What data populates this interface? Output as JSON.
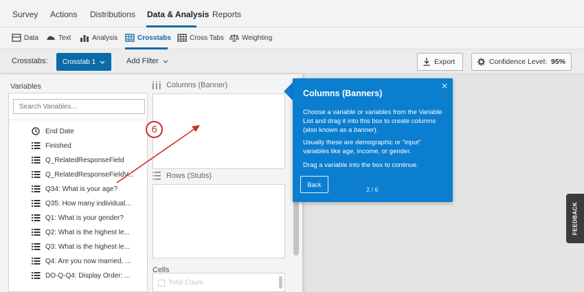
{
  "nav": {
    "tabs": [
      {
        "label": "Survey"
      },
      {
        "label": "Actions"
      },
      {
        "label": "Distributions"
      },
      {
        "label": "Data & Analysis"
      },
      {
        "label": "Reports"
      }
    ],
    "active_tab": "Data & Analysis"
  },
  "subnav": {
    "items": [
      {
        "label": "Data",
        "icon": "data-icon"
      },
      {
        "label": "Text",
        "icon": "text-icon"
      },
      {
        "label": "Analysis",
        "icon": "bar-chart-icon"
      },
      {
        "label": "Crosstabs",
        "icon": "grid-icon"
      },
      {
        "label": "Cross Tabs",
        "icon": "grid-icon"
      },
      {
        "label": "Weighting",
        "icon": "scale-icon"
      }
    ],
    "active_item": "Crosstabs"
  },
  "toolbar": {
    "crosstabs_label": "Crosstabs:",
    "crosstab_button": "Crosstab 1",
    "add_filter": "Add Filter",
    "export_label": "Export",
    "confidence_label": "Confidence Level:",
    "confidence_value": "95%"
  },
  "variables": {
    "title": "Variables",
    "search_placeholder": "Search Variables...",
    "items": [
      {
        "label": "End Date",
        "icon": "clock-icon"
      },
      {
        "label": "Finished",
        "icon": "list-icon"
      },
      {
        "label": "Q_RelatedResponseField",
        "icon": "list-icon"
      },
      {
        "label": "Q_RelatedResponseFieldV...",
        "icon": "list-icon"
      },
      {
        "label": "Q34: What is your age?",
        "icon": "list-icon"
      },
      {
        "label": "Q35: How many individual...",
        "icon": "list-icon"
      },
      {
        "label": "Q1: What is your gender?",
        "icon": "list-icon"
      },
      {
        "label": "Q2: What is the highest le...",
        "icon": "list-icon"
      },
      {
        "label": "Q3: What is the highest le...",
        "icon": "list-icon"
      },
      {
        "label": "Q4: Are you now married, ...",
        "icon": "list-icon"
      },
      {
        "label": "DO-Q-Q4: Display Order: ...",
        "icon": "list-icon"
      }
    ]
  },
  "sections": {
    "columns": "Columns (Banner)",
    "rows": "Rows (Stubs)",
    "cells": "Cells",
    "cells_option": "Total Count"
  },
  "popup": {
    "title": "Columns (Banners)",
    "close": "×",
    "p1_a": "Choose a variable or variables from the Variable List and drag it into this box to create ",
    "p1_em1": "columns",
    "p1_b": " (also known as a ",
    "p1_em2": "banner",
    "p1_c": ").",
    "p2": "Usually these are demographic or “input” variables like age, income, or gender.",
    "p3": "Drag a variable into the box to continue.",
    "back": "Back",
    "pager": "2 / 6"
  },
  "annotation": {
    "step": "6",
    "color": "#c9302c"
  },
  "feedback": "FEEDBACK",
  "colors": {
    "accent": "#0b6ba8",
    "popup": "#0b7ed0",
    "annotation": "#c9302c"
  }
}
